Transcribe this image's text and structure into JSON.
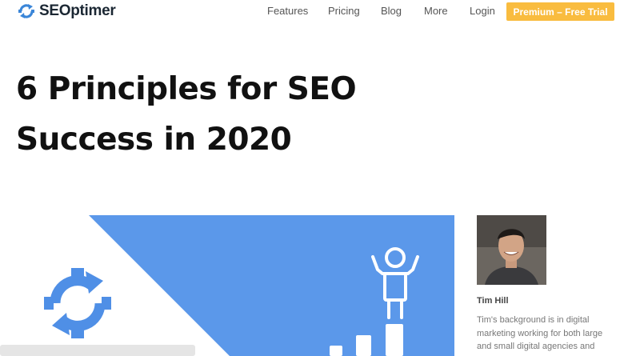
{
  "brand": {
    "name": "SEOptimer",
    "logo_icon": "gear-sync-icon",
    "color": "#3b86d8"
  },
  "nav": {
    "items": [
      {
        "label": "Features"
      },
      {
        "label": "Pricing"
      },
      {
        "label": "Blog"
      },
      {
        "label": "More"
      },
      {
        "label": "Login"
      }
    ],
    "cta_label": "Premium – Free Trial",
    "cta_color": "#f9bc3f"
  },
  "article": {
    "title_line1": "6 Principles for SEO",
    "title_line2": "Success in 2020"
  },
  "hero": {
    "accent_color": "#5b98ea",
    "icons": [
      "gear-sync-icon",
      "person-arms-up-icon",
      "bar-steps-icon"
    ]
  },
  "author": {
    "name": "Tim Hill",
    "bio": "Tim's background is in digital marketing working for both large and small digital agencies and diverse client types. He has a passion for tech"
  }
}
